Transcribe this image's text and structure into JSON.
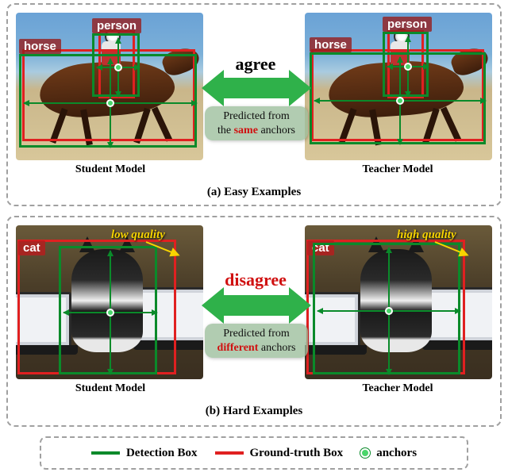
{
  "colors": {
    "detection": "#0a8a2a",
    "ground_truth": "#e02020",
    "anchor": "#49d66a",
    "arrow": "#2fb14a",
    "annotation": "#f7d400"
  },
  "panel_a": {
    "caption": "(a) Easy Examples",
    "left_caption": "Student Model",
    "right_caption": "Teacher Model",
    "arrow_label": "agree",
    "pred_badge_line1": "Predicted from",
    "pred_badge_line2_pre": "the ",
    "pred_badge_line2_em": "same",
    "pred_badge_line2_post": " anchors",
    "labels": {
      "horse": "horse",
      "person": "person"
    }
  },
  "panel_b": {
    "caption": "(b) Hard Examples",
    "left_caption": "Student Model",
    "right_caption": "Teacher Model",
    "arrow_label": "disagree",
    "pred_badge_line1": "Predicted from",
    "pred_badge_line2_em": "different",
    "pred_badge_line2_post": " anchors",
    "labels": {
      "cat": "cat"
    },
    "ann_left": "low quality",
    "ann_right": "high quality"
  },
  "legend": {
    "detection": "Detection Box",
    "ground_truth": "Ground-truth Box",
    "anchors": "anchors"
  }
}
